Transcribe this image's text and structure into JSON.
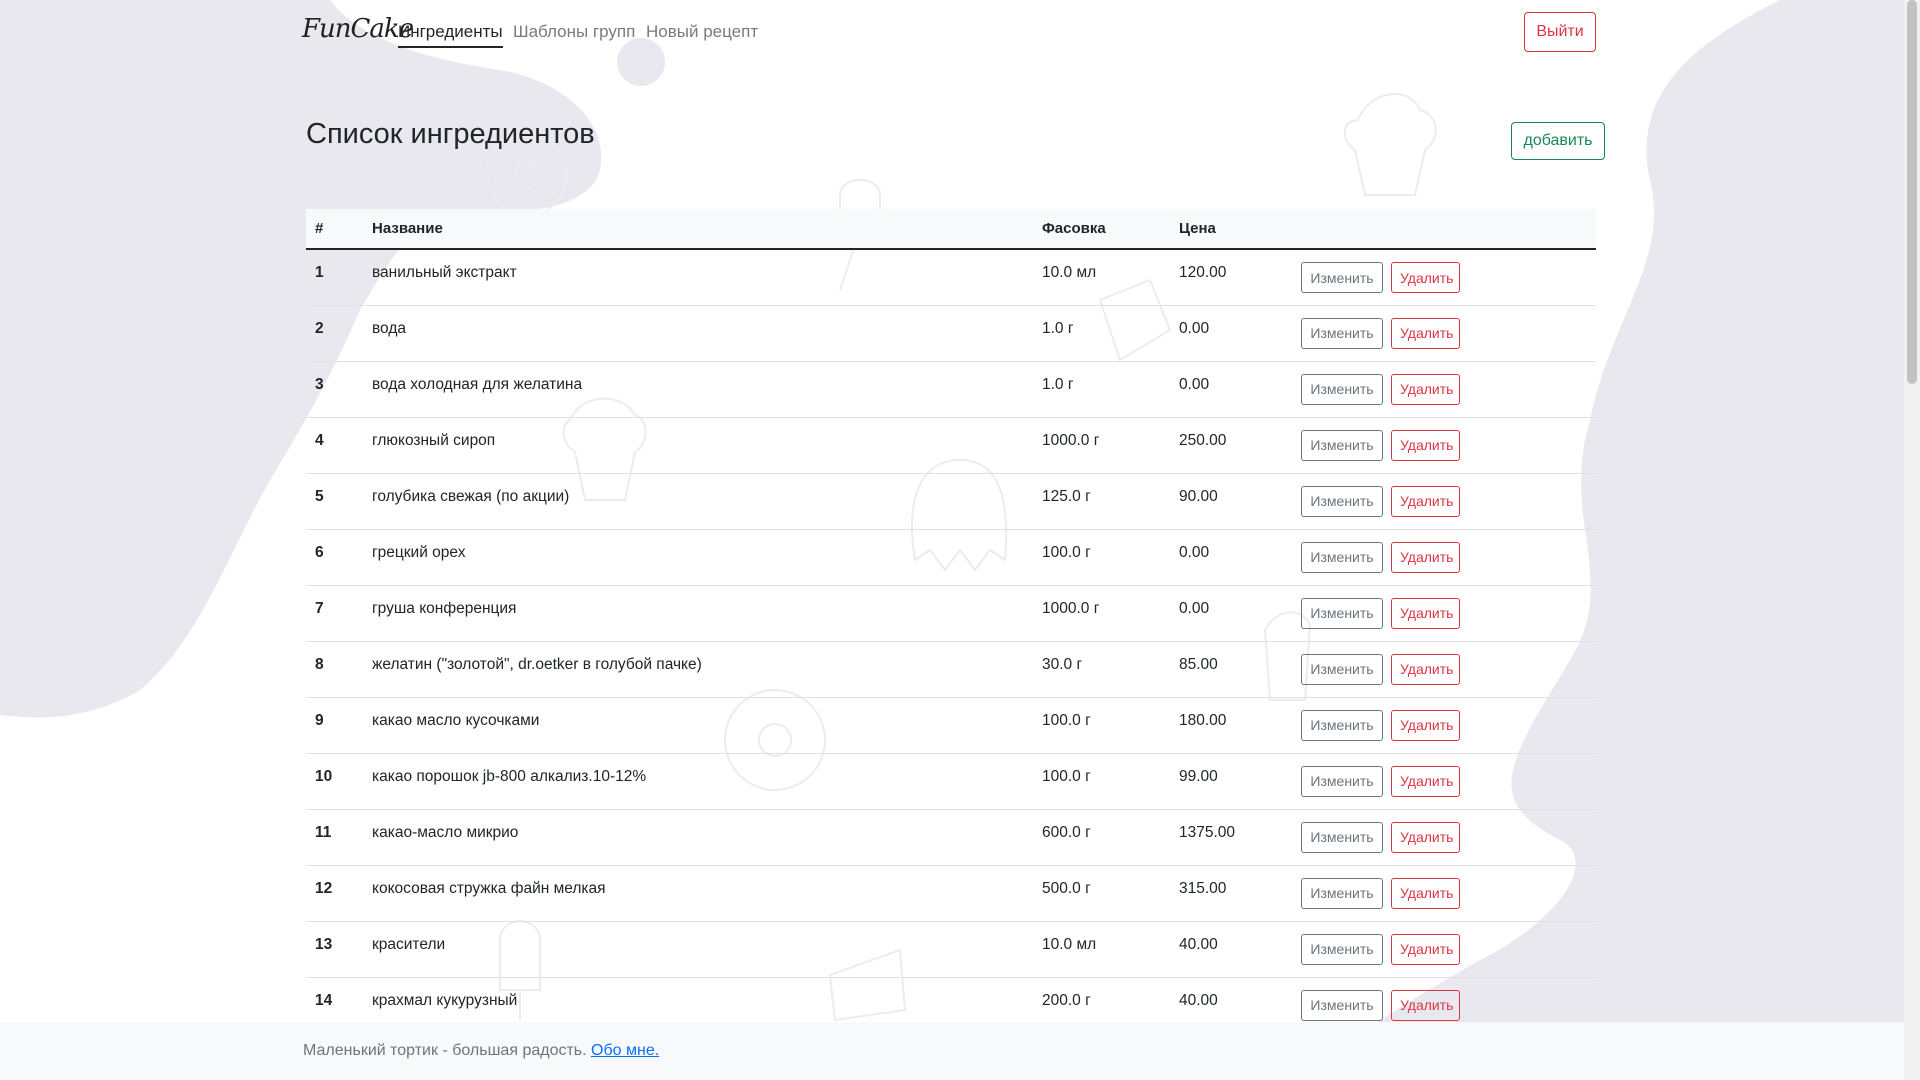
{
  "nav": {
    "brand": "FunCake",
    "links": [
      "Ингредиенты",
      "Шаблоны групп",
      "Новый рецепт"
    ],
    "logout": "Выйти"
  },
  "page": {
    "title": "Список ингредиентов",
    "add_label": "добавить"
  },
  "table": {
    "headers": [
      "#",
      "Название",
      "Фасовка",
      "Цена"
    ],
    "edit_label": "Изменить",
    "delete_label": "Удалить",
    "rows": [
      {
        "num": "1",
        "name": "ванильный экстракт",
        "pack": "10.0 мл",
        "price": "120.00"
      },
      {
        "num": "2",
        "name": "вода",
        "pack": "1.0 г",
        "price": "0.00"
      },
      {
        "num": "3",
        "name": "вода холодная для желатина",
        "pack": "1.0 г",
        "price": "0.00"
      },
      {
        "num": "4",
        "name": "глюкозный сироп",
        "pack": "1000.0 г",
        "price": "250.00"
      },
      {
        "num": "5",
        "name": "голубика свежая (по акции)",
        "pack": "125.0 г",
        "price": "90.00"
      },
      {
        "num": "6",
        "name": "грецкий орех",
        "pack": "100.0 г",
        "price": "0.00"
      },
      {
        "num": "7",
        "name": "груша конференция",
        "pack": "1000.0 г",
        "price": "0.00"
      },
      {
        "num": "8",
        "name": "желатин (\"золотой\", dr.oetker в голубой пачке)",
        "pack": "30.0 г",
        "price": "85.00"
      },
      {
        "num": "9",
        "name": "какао масло кусочками",
        "pack": "100.0 г",
        "price": "180.00"
      },
      {
        "num": "10",
        "name": "какао порошок jb-800 алкализ.10-12%",
        "pack": "100.0 г",
        "price": "99.00"
      },
      {
        "num": "11",
        "name": "какао-масло микрио",
        "pack": "600.0 г",
        "price": "1375.00"
      },
      {
        "num": "12",
        "name": "кокосовая стружка файн мелкая",
        "pack": "500.0 г",
        "price": "315.00"
      },
      {
        "num": "13",
        "name": "красители",
        "pack": "10.0 мл",
        "price": "40.00"
      },
      {
        "num": "14",
        "name": "крахмал кукурузный",
        "pack": "200.0 г",
        "price": "40.00"
      }
    ]
  },
  "footer": {
    "text": "Маленький тортик - большая радость.",
    "link": "Обо мне."
  },
  "colors": {
    "blob": "#e8e8ee",
    "danger": "#dc3545",
    "success": "#198754",
    "secondary": "#6c757d",
    "link": "#0d6efd"
  }
}
